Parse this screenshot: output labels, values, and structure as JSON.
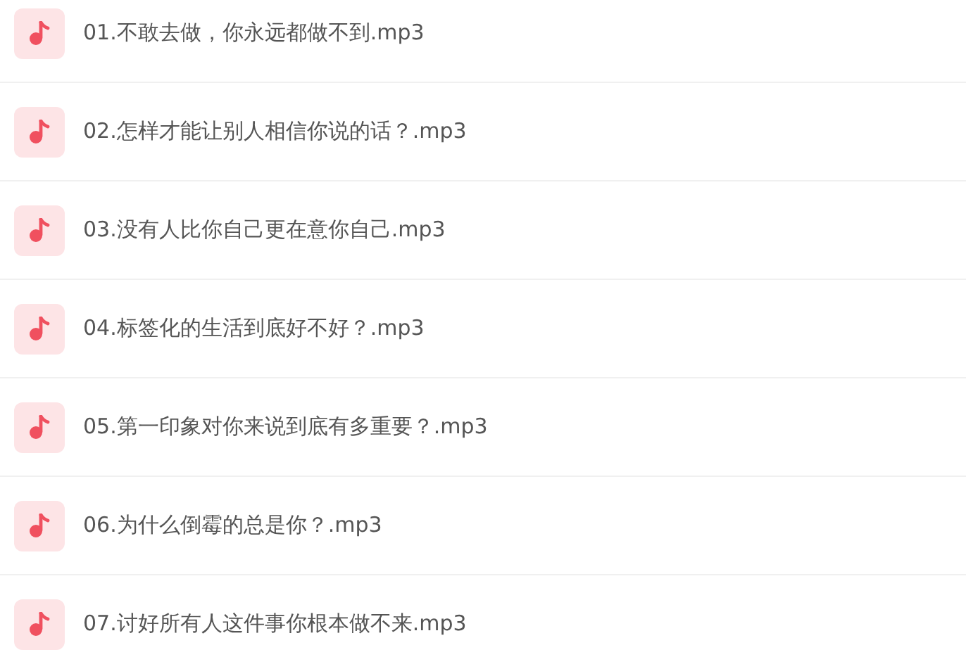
{
  "files": [
    {
      "kind": "audio",
      "name": "01.不敢去做，你永远都做不到.mp3"
    },
    {
      "kind": "audio",
      "name": "02.怎样才能让别人相信你说的话？.mp3"
    },
    {
      "kind": "audio",
      "name": "03.没有人比你自己更在意你自己.mp3"
    },
    {
      "kind": "audio",
      "name": "04.标签化的生活到底好不好？.mp3"
    },
    {
      "kind": "audio",
      "name": "05.第一印象对你来说到底有多重要？.mp3"
    },
    {
      "kind": "audio",
      "name": "06.为什么倒霉的总是你？.mp3"
    },
    {
      "kind": "audio",
      "name": "07.讨好所有人这件事你根本做不来.mp3"
    }
  ]
}
